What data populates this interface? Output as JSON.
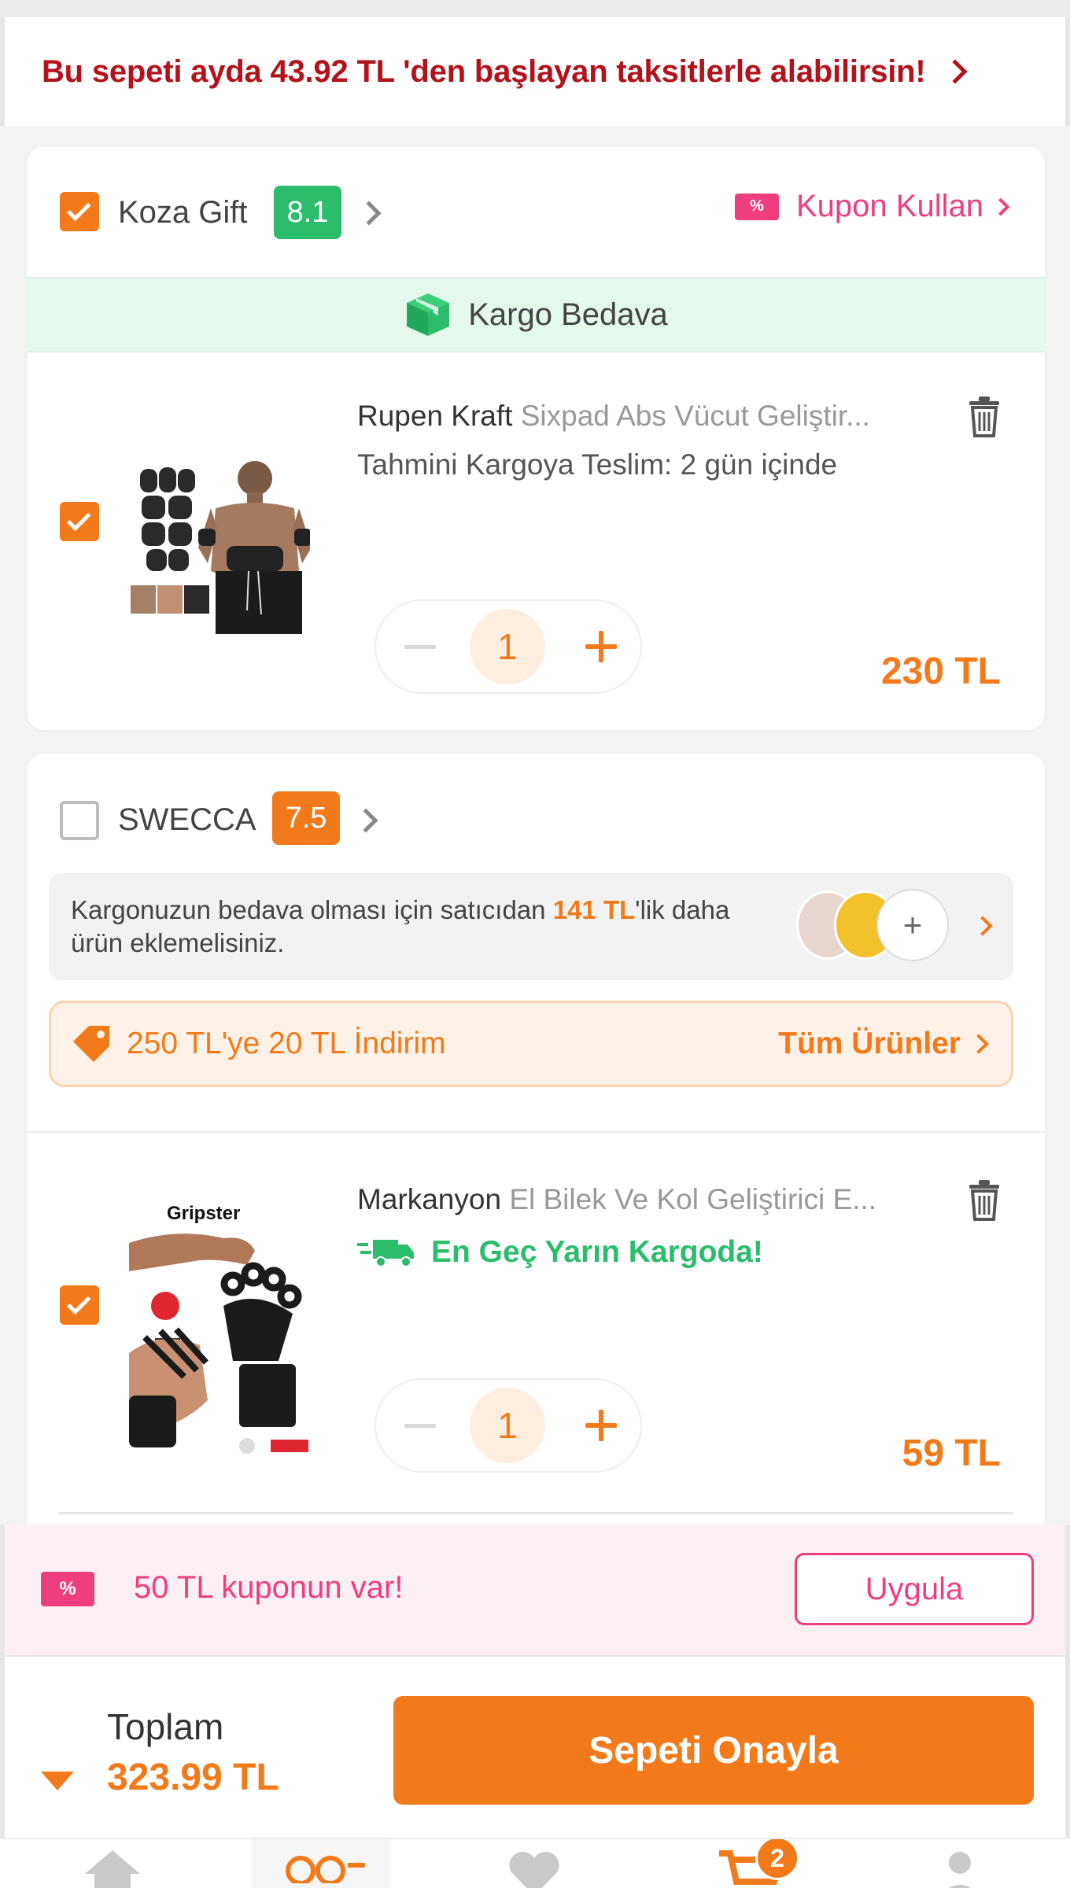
{
  "banner": {
    "text": "Bu sepeti ayda 43.92 TL 'den başlayan taksitlerle alabilirsin!"
  },
  "sellers": [
    {
      "name": "Koza Gift",
      "score": "8.1",
      "score_color": "#2bbd6b",
      "checked": true,
      "coupon_link": "Kupon Kullan",
      "free_shipping": "Kargo Bedava",
      "product": {
        "brand": "Rupen Kraft",
        "name": "Sixpad Abs Vücut Geliştir...",
        "delivery": "Tahmini Kargoya Teslim: 2 gün içinde",
        "quantity": "1",
        "price": "230 TL"
      }
    },
    {
      "name": "SWECCA",
      "score": "7.5",
      "score_color": "#f27a1a",
      "checked": false,
      "shipping_notice": {
        "before": "Kargonuzun bedava olması için satıcıdan ",
        "amount": "141 TL",
        "after": "'lik daha ürün eklemelisiniz."
      },
      "promo": {
        "text": "250 TL'ye 20 TL İndirim",
        "link": "Tüm Ürünler"
      },
      "product": {
        "brand": "Markanyon",
        "name": "El Bilek Ve Kol Geliştirici E...",
        "delivery": "En Geç Yarın Kargoda!",
        "quantity": "1",
        "price": "59 TL",
        "image_label": "Gripster"
      }
    }
  ],
  "coupon_strip": {
    "text": "50 TL kuponun var!",
    "button": "Uygula"
  },
  "footer": {
    "total_label": "Toplam",
    "total_value": "323.99 TL",
    "confirm_button": "Sepeti Onayla"
  },
  "navbar": {
    "cart_badge": "2"
  },
  "colors": {
    "accent": "#f27a1a",
    "pink": "#ee3e7f",
    "green": "#2bbd6b",
    "banner_red": "#b3121b"
  }
}
